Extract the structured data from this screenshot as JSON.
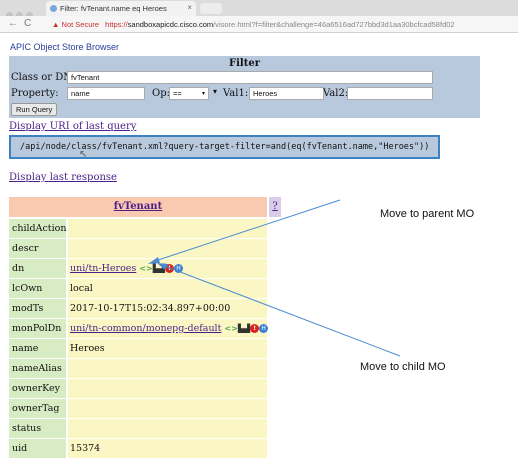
{
  "browser": {
    "tab_title": "Filter: fvTenant.name eq Heroes",
    "tab_close": "×",
    "nav_back": "←",
    "nav_reload": "C",
    "security_icon": "▲",
    "security_text": "Not Secure",
    "url_scheme": "https://",
    "url_host": "sandboxapicdc.cisco.com",
    "url_path": "/visore.html?f=filter&challenge=46a6516ad727bbd3d1aa30bcfcad58fd02"
  },
  "page": {
    "title": "APIC Object Store Browser"
  },
  "filter": {
    "title": "Filter",
    "class_label": "Class or DN:",
    "class_value": "fvTenant",
    "property_label": "Property:",
    "property_value": "name",
    "op_label": "Op:",
    "op_value": "==",
    "val1_label": "Val1:",
    "val1_value": "Heroes",
    "val2_label": "Val2:",
    "val2_value": "",
    "run_button": "Run Query"
  },
  "links": {
    "display_uri": "Display URI of last query",
    "display_response": "Display last response"
  },
  "uri": {
    "text": "/api/node/class/fvTenant.xml?query-target-filter=and(eq(fvTenant.name,\"Heroes\"))"
  },
  "result": {
    "class_name": "fvTenant",
    "help": "?",
    "rows": [
      {
        "key": "childAction",
        "value": ""
      },
      {
        "key": "descr",
        "value": ""
      },
      {
        "key": "dn",
        "value": "uni/tn-Heroes"
      },
      {
        "key": "lcOwn",
        "value": "local"
      },
      {
        "key": "modTs",
        "value": "2017-10-17T15:02:34.897+00:00"
      },
      {
        "key": "monPolDn",
        "value": "uni/tn-common/monepg-default"
      },
      {
        "key": "name",
        "value": "Heroes"
      },
      {
        "key": "nameAlias",
        "value": ""
      },
      {
        "key": "ownerKey",
        "value": ""
      },
      {
        "key": "ownerTag",
        "value": ""
      },
      {
        "key": "status",
        "value": ""
      },
      {
        "key": "uid",
        "value": "15374"
      }
    ],
    "icon_glyphs": {
      "left": "<",
      "right": ">",
      "stats": "▙▟",
      "fault": "!",
      "health": "H"
    }
  },
  "annotations": {
    "parent": "Move to parent MO",
    "child": "Move to child MO"
  },
  "colors": {
    "filter_bg": "#b8c8dd",
    "key_cell": "#d8ecc4",
    "value_cell": "#faf7c4",
    "header_cell": "#f9c9b0",
    "link": "#4b1f88",
    "arrow": "#4a8ad0"
  }
}
